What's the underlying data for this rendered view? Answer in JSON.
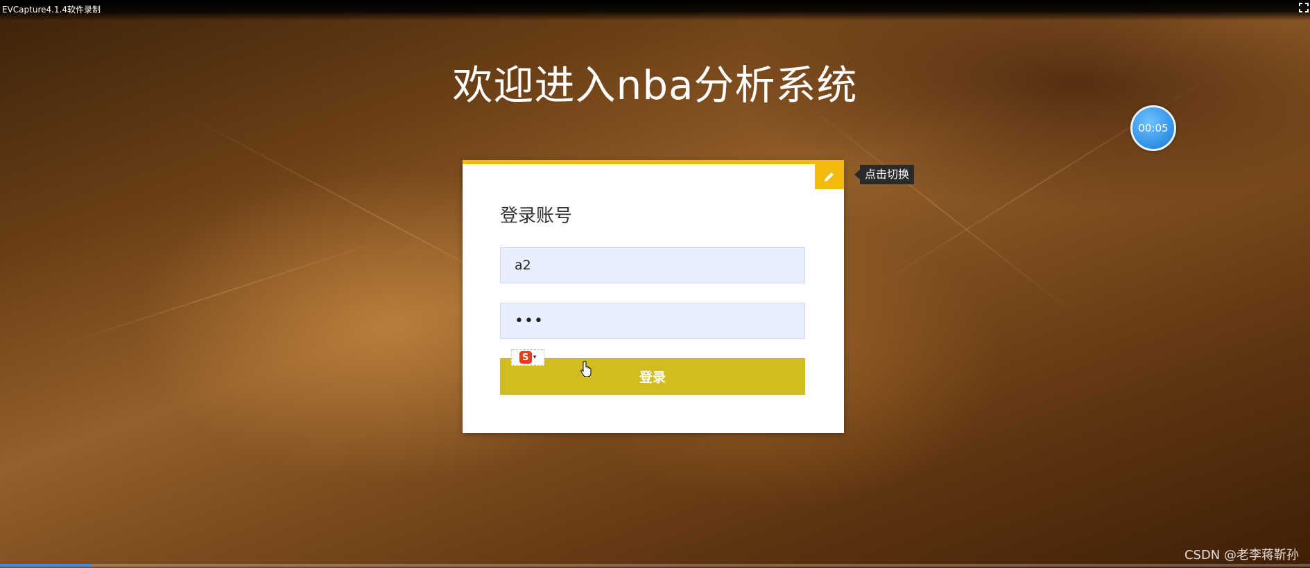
{
  "window": {
    "title": "EVCapture4.1.4软件录制"
  },
  "page": {
    "title": "欢迎进入nba分析系统"
  },
  "recorder": {
    "timer": "00:05",
    "progress_fraction": 0.07
  },
  "login_card": {
    "accent_color": "#f2b90f",
    "toggle_tooltip": "点击切换",
    "toggle_icon": "pencil-icon",
    "heading": "登录账号",
    "username_value": "a2",
    "password_value": "•••",
    "login_label": "登录",
    "login_color": "#d2bc1f"
  },
  "ime": {
    "logo_char": "S"
  },
  "watermark": {
    "text": "CSDN @老李蒋靳孙"
  }
}
